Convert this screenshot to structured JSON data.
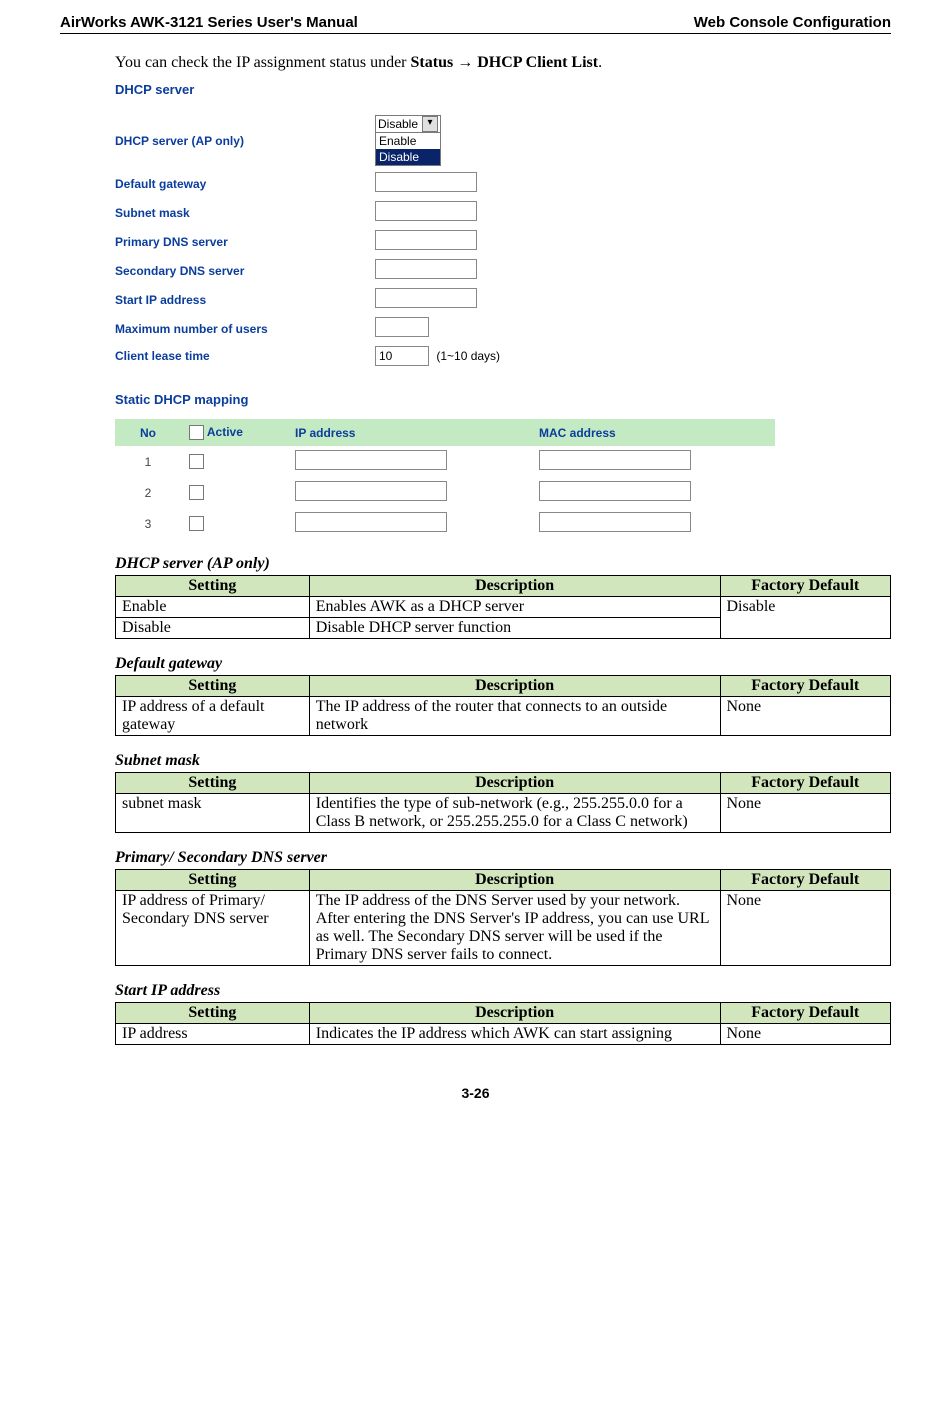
{
  "header": {
    "left": "AirWorks AWK-3121 Series User's Manual",
    "right": "Web Console Configuration"
  },
  "intro": {
    "leading": "You can check the IP assignment status under ",
    "bold1": "Status ",
    "arrow": "→",
    "bold2": " DHCP Client List",
    "period": "."
  },
  "form": {
    "title": "DHCP server",
    "labels": {
      "dhcp_server": "DHCP server (AP only)",
      "default_gateway": "Default gateway",
      "subnet_mask": "Subnet mask",
      "primary_dns": "Primary DNS server",
      "secondary_dns": "Secondary DNS server",
      "start_ip": "Start IP address",
      "max_users": "Maximum number of users",
      "lease_time": "Client lease time"
    },
    "dhcp_select": {
      "display": "Disable",
      "opt_enable": "Enable",
      "opt_disable": "Disable"
    },
    "lease_value": "10",
    "lease_note": "(1~10 days)"
  },
  "static_map": {
    "title": "Static DHCP mapping",
    "headers": {
      "no": "No",
      "active": "Active",
      "ip": "IP address",
      "mac": "MAC address"
    },
    "rows": [
      "1",
      "2",
      "3"
    ]
  },
  "tables": {
    "col_setting": "Setting",
    "col_description": "Description",
    "col_default": "Factory Default"
  },
  "t_dhcp": {
    "title": "DHCP server (AP only)",
    "r1_s": "Enable",
    "r1_d": "Enables AWK as a DHCP server",
    "r2_s": "Disable",
    "r2_d": "Disable DHCP server function",
    "def": "Disable"
  },
  "t_gateway": {
    "title": "Default gateway",
    "r1_s": "IP address of a default gateway",
    "r1_d": "The IP address of the router that connects to an outside network",
    "def": "None"
  },
  "t_subnet": {
    "title": "Subnet mask",
    "r1_s": "subnet mask",
    "r1_d": "Identifies the type of sub-network (e.g., 255.255.0.0 for a Class B network, or 255.255.255.0 for a Class C network)",
    "def": "None"
  },
  "t_dns": {
    "title": "Primary/ Secondary DNS server",
    "r1_s": "IP address of Primary/ Secondary DNS server",
    "r1_d": "The IP address of the DNS Server used by your network. After entering the DNS Server's IP address, you can use URL as well. The Secondary DNS server will be used if the Primary DNS server fails to connect.",
    "def": "None"
  },
  "t_start": {
    "title": "Start IP address",
    "r1_s": "IP address",
    "r1_d": "Indicates the IP address which AWK can start assigning",
    "def": "None"
  },
  "page_num": "3-26"
}
